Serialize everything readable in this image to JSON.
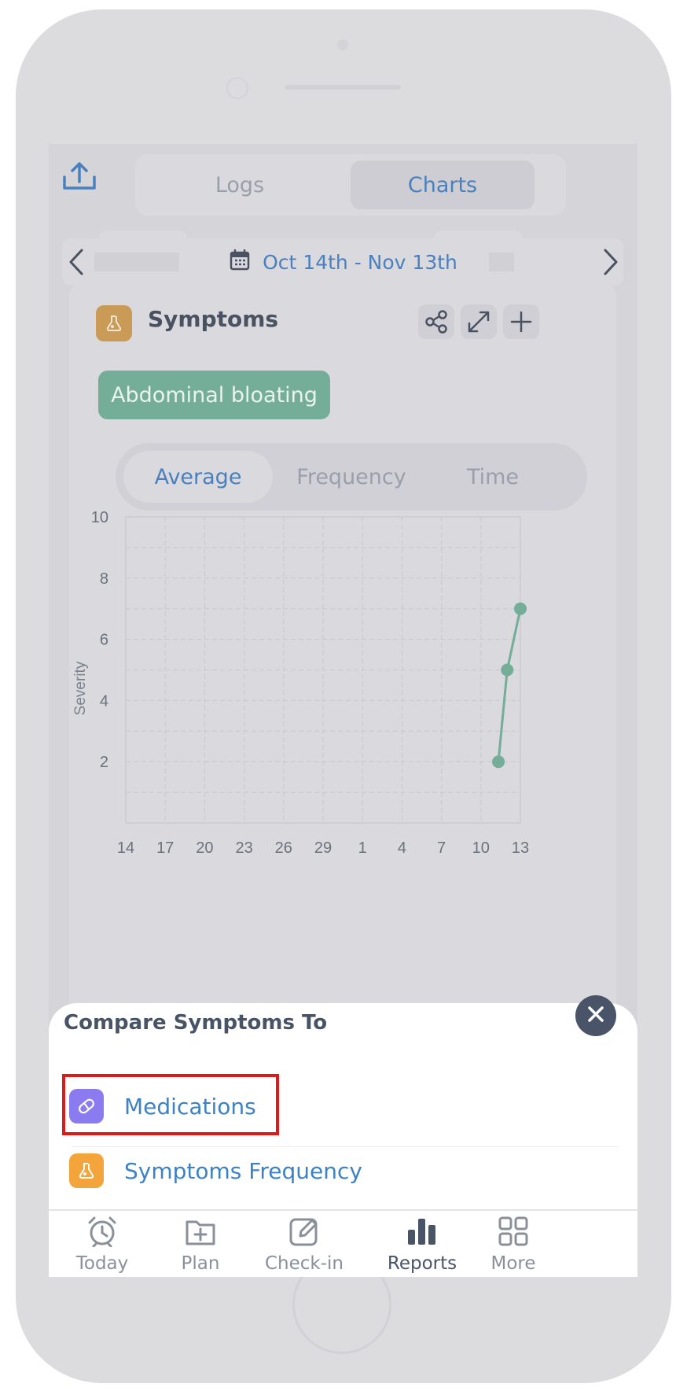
{
  "header": {
    "tabs": [
      {
        "label": "Logs",
        "active": false
      },
      {
        "label": "Charts",
        "active": true
      }
    ],
    "share_icon": "share-upload-icon"
  },
  "date_range": {
    "label": "Oct 14th - Nov 13th"
  },
  "symptoms_card": {
    "title": "Symptoms",
    "selected_symptom": "Abdominal bloating",
    "modes": [
      {
        "label": "Average",
        "active": true
      },
      {
        "label": "Frequency",
        "active": false
      },
      {
        "label": "Time",
        "active": false
      }
    ]
  },
  "chart_data": {
    "type": "line",
    "ylabel": "Severity",
    "ylim": [
      0,
      10
    ],
    "yticks": [
      2,
      4,
      6,
      8,
      10
    ],
    "x_tick_labels": [
      "14",
      "17",
      "20",
      "23",
      "26",
      "29",
      "1",
      "4",
      "7",
      "10",
      "13"
    ],
    "x_index_range": [
      0,
      30
    ],
    "series": [
      {
        "color": "#74ad98",
        "points": [
          {
            "x": 28.33,
            "y": 2
          },
          {
            "x": 29.0,
            "y": 5
          },
          {
            "x": 30.0,
            "y": 7
          }
        ]
      }
    ],
    "grid": true
  },
  "sheet": {
    "title": "Compare Symptoms To",
    "items": [
      {
        "label": "Medications",
        "icon": "pill-icon",
        "color": "#8a7cf0"
      },
      {
        "label": "Symptoms Frequency",
        "icon": "symptom-icon",
        "color": "#f3a43a"
      }
    ]
  },
  "bottom_nav": [
    {
      "label": "Today",
      "icon": "alarm-clock-icon",
      "active": false
    },
    {
      "label": "Plan",
      "icon": "folder-plus-icon",
      "active": false
    },
    {
      "label": "Check-in",
      "icon": "edit-icon",
      "active": false
    },
    {
      "label": "Reports",
      "icon": "bar-chart-icon",
      "active": true
    },
    {
      "label": "More",
      "icon": "grid-icon",
      "active": false
    }
  ],
  "colors": {
    "accent_blue": "#4a80bd",
    "tag_green": "#74ad98",
    "symptom_orange": "#c99b57",
    "highlight_red": "#e01818"
  }
}
